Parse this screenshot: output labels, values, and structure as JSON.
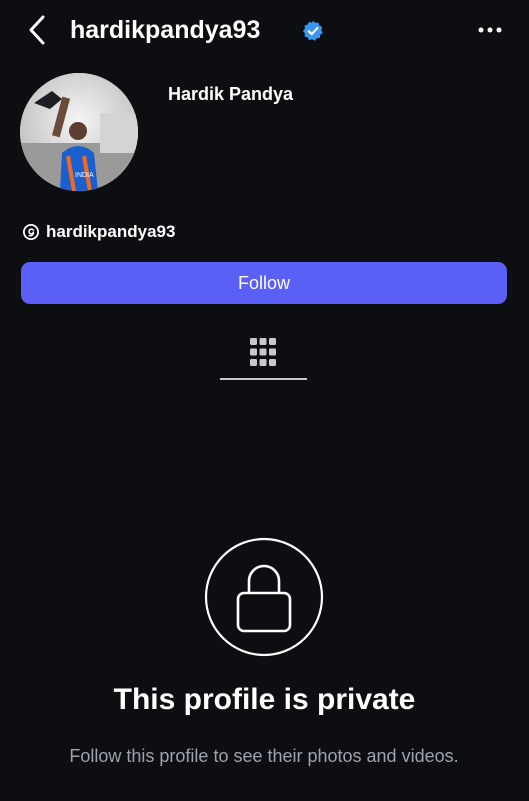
{
  "header": {
    "username": "hardikpandya93",
    "back_icon": "chevron-left-icon",
    "verified_icon": "verified-badge-icon",
    "more_icon": "ellipsis-icon"
  },
  "profile": {
    "display_name": "Hardik Pandya",
    "avatar": "profile-photo",
    "threads_icon": "threads-icon",
    "threads_handle": "hardikpandya93"
  },
  "actions": {
    "follow_label": "Follow"
  },
  "tabs": {
    "grid_icon": "grid-icon"
  },
  "private": {
    "lock_icon": "lock-icon",
    "title": "This profile is private",
    "subtitle": "Follow this profile to see their photos and videos."
  },
  "colors": {
    "background": "#0c0e12",
    "follow_button": "#5a5ff6",
    "verified": "#3b97f3",
    "subtitle_text": "#9ea3ad"
  }
}
